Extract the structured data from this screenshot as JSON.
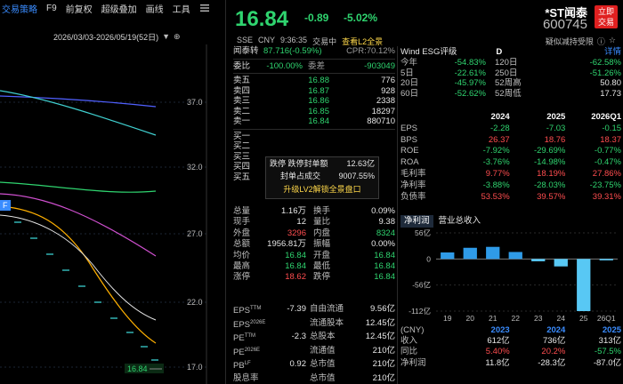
{
  "toolbar": {
    "items": [
      "交易策略",
      "F9",
      "前复权",
      "超级叠加",
      "画线",
      "工具"
    ],
    "active_index": 0
  },
  "chart": {
    "range_label": "2026/03/03-2026/05/19(52日)",
    "y_ticks": [
      "37.0",
      "32.0",
      "27.0",
      "22.0",
      "17.0"
    ],
    "current_price_tag": "16.84",
    "marker_label": "F",
    "colors": {
      "ma1": "#ffffff",
      "ma2": "#ffb000",
      "ma3": "#d050d0",
      "ma4": "#40d0d0",
      "ma5": "#5060ff",
      "candle": "#40e0e0"
    }
  },
  "quote": {
    "last_price": "16.84",
    "change": "-0.89",
    "change_pct": "-5.02%",
    "name": "*ST闻泰",
    "code": "600745",
    "buy_button": [
      "立即",
      "交易"
    ],
    "exchange": "SSE",
    "currency": "CNY",
    "time": "9:36:35",
    "status": "交易中",
    "l2_link": "查看L2全景",
    "fav_text": "疑似减持受限",
    "bond": {
      "label": "闻泰转",
      "value": "87.716(-0.59%)",
      "cpr_label": "CPR:",
      "cpr_value": "70.12%"
    }
  },
  "book": {
    "weibi": {
      "label": "委比",
      "value": "-100.00%",
      "label2": "委差",
      "value2": "-903049"
    },
    "asks": [
      {
        "label": "卖五",
        "price": "16.88",
        "vol": "776"
      },
      {
        "label": "卖四",
        "price": "16.87",
        "vol": "928"
      },
      {
        "label": "卖三",
        "price": "16.86",
        "vol": "2338"
      },
      {
        "label": "卖二",
        "price": "16.85",
        "vol": "18297"
      },
      {
        "label": "卖一",
        "price": "16.84",
        "vol": "880710"
      }
    ],
    "bids": [
      {
        "label": "买一"
      },
      {
        "label": "买二"
      },
      {
        "label": "买三"
      },
      {
        "label": "买四"
      },
      {
        "label": "买五"
      }
    ]
  },
  "popup": {
    "row1_label": "跌停 跌停封单额",
    "row1_value": "12.63亿",
    "row2_label": "封单占成交",
    "row2_value": "9007.55%",
    "button": "升级LV2解锁全景盘口"
  },
  "stats": [
    {
      "k": "总量",
      "v": "1.16万",
      "k2": "换手",
      "v2": "0.09%",
      "vc": "wht",
      "v2c": "wht"
    },
    {
      "k": "现手",
      "v": "12",
      "k2": "量比",
      "v2": "9.38",
      "vc": "wht",
      "v2c": "wht"
    },
    {
      "k": "外盘",
      "v": "3296",
      "k2": "内盘",
      "v2": "8324",
      "vc": "red",
      "v2c": "grn"
    },
    {
      "k": "总额",
      "v": "1956.81万",
      "k2": "振幅",
      "v2": "0.00%",
      "vc": "wht",
      "v2c": "wht"
    },
    {
      "k": "均价",
      "v": "16.84",
      "k2": "开盘",
      "v2": "16.84",
      "vc": "grn",
      "v2c": "grn"
    },
    {
      "k": "最高",
      "v": "16.84",
      "k2": "最低",
      "v2": "16.84",
      "vc": "grn",
      "v2c": "grn"
    },
    {
      "k": "涨停",
      "v": "18.62",
      "k2": "跌停",
      "v2": "16.84",
      "vc": "red",
      "v2c": "grn"
    }
  ],
  "stats2": [
    {
      "k": "EPS",
      "sup": "TTM",
      "v": "-7.39",
      "k2": "自由流通",
      "v2": "9.56亿"
    },
    {
      "k": "EPS",
      "sup": "2026E",
      "v": "",
      "k2": "流通股本",
      "v2": "12.45亿"
    },
    {
      "k": "PE",
      "sup": "TTM",
      "v": "-2.3",
      "k2": "总股本",
      "v2": "12.45亿"
    },
    {
      "k": "PE",
      "sup": "2026E",
      "v": "",
      "k2": "流通值",
      "v2": "210亿"
    },
    {
      "k": "PB",
      "sup": "LF",
      "v": "0.92",
      "k2": "总市值",
      "v2": "210亿"
    },
    {
      "k": "股息率",
      "sup": "TTM",
      "v": "",
      "k2": "总市值",
      "v2": "210亿"
    }
  ],
  "fund": {
    "wind_label": "Wind ESG评级",
    "wind_grade": "D",
    "more": "详情",
    "rows": [
      {
        "a": "今年",
        "b": "-54.83%",
        "c": "120日",
        "d": "-62.58%",
        "bc": "grn",
        "dc": "grn"
      },
      {
        "a": "5日",
        "b": "-22.61%",
        "c": "250日",
        "d": "-51.26%",
        "bc": "grn",
        "dc": "grn"
      },
      {
        "a": "20日",
        "b": "-45.97%",
        "c": "52周高",
        "d": "50.80",
        "bc": "grn",
        "dc": "wht"
      },
      {
        "a": "60日",
        "b": "-52.62%",
        "c": "52周低",
        "d": "17.73",
        "bc": "grn",
        "dc": "wht"
      }
    ]
  },
  "fin_table": {
    "headers": [
      "",
      "2024",
      "2025",
      "2026Q1"
    ],
    "rows": [
      {
        "k": "EPS",
        "v": [
          "-2.28",
          "-7.03",
          "-0.15"
        ]
      },
      {
        "k": "BPS",
        "v": [
          "26.37",
          "18.76",
          "18.37"
        ]
      },
      {
        "k": "ROE",
        "v": [
          "-7.92%",
          "-29.69%",
          "-0.77%"
        ]
      },
      {
        "k": "ROA",
        "v": [
          "-3.76%",
          "-14.98%",
          "-0.47%"
        ]
      },
      {
        "k": "毛利率",
        "v": [
          "9.77%",
          "18.19%",
          "27.86%"
        ]
      },
      {
        "k": "净利率",
        "v": [
          "-3.88%",
          "-28.03%",
          "-23.75%"
        ]
      },
      {
        "k": "负债率",
        "v": [
          "53.53%",
          "39.57%",
          "39.31%"
        ]
      }
    ]
  },
  "bar_section": {
    "tabs": [
      "净利润",
      "营业总收入"
    ],
    "y_ticks": [
      "56亿",
      "0",
      "-56亿",
      "-112亿"
    ],
    "x_labels": [
      "19",
      "20",
      "21",
      "22",
      "23",
      "24",
      "25",
      "26Q1"
    ]
  },
  "chart_data": {
    "type": "bar",
    "categories": [
      "19",
      "20",
      "21",
      "22",
      "23",
      "24",
      "25",
      "26Q1"
    ],
    "series": [
      {
        "values": [
          14,
          24,
          26,
          15,
          -5,
          -16,
          -112,
          -3
        ]
      }
    ],
    "ylabel": "",
    "ylim": [
      -112,
      56
    ]
  },
  "annual": {
    "headers": [
      "(CNY)",
      "2023",
      "2024",
      "2025"
    ],
    "rows": [
      {
        "k": "收入",
        "v": [
          "612亿",
          "736亿",
          "313亿"
        ],
        "c": [
          "wht",
          "wht",
          "wht"
        ]
      },
      {
        "k": "同比",
        "v": [
          "5.40%",
          "20.2%",
          "-57.5%"
        ],
        "c": [
          "red",
          "red",
          "grn"
        ]
      },
      {
        "k": "净利润",
        "v": [
          "11.8亿",
          "-28.3亿",
          "-87.0亿"
        ],
        "c": [
          "wht",
          "wht",
          "wht"
        ]
      }
    ]
  }
}
